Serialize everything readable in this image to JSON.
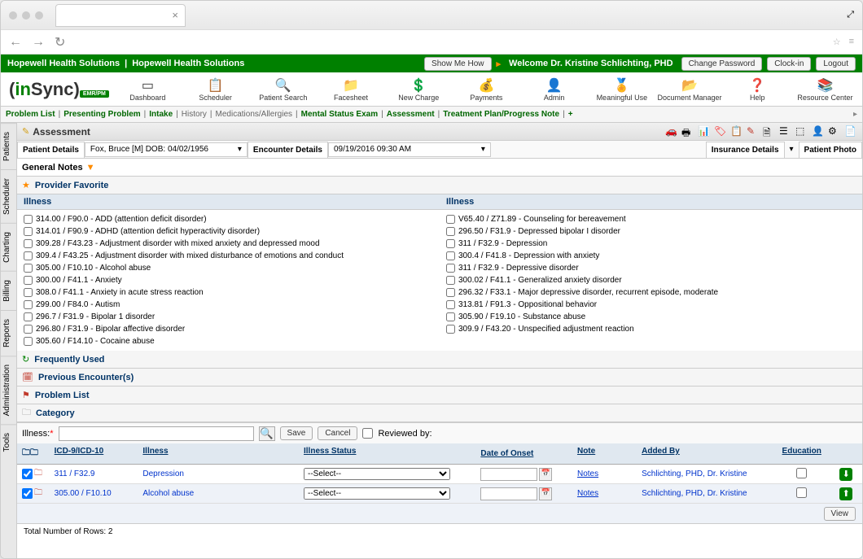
{
  "greenbar": {
    "org1": "Hopewell Health Solutions",
    "org2": "Hopewell Health Solutions",
    "showme": "Show Me How",
    "welcome": "Welcome Dr. Kristine Schlichting, PHD",
    "changepw": "Change Password",
    "clockin": "Clock-in",
    "logout": "Logout"
  },
  "logo": {
    "prefix": "in",
    "suffix": "Sync",
    "sub": "EMR/PM"
  },
  "toolbar": [
    {
      "label": "Dashboard",
      "icon": "▭"
    },
    {
      "label": "Scheduler",
      "icon": "📋"
    },
    {
      "label": "Patient Search",
      "icon": "🔍"
    },
    {
      "label": "Facesheet",
      "icon": "📁"
    },
    {
      "label": "New Charge",
      "icon": "💲"
    },
    {
      "label": "Payments",
      "icon": "💰"
    },
    {
      "label": "Admin",
      "icon": "👤"
    },
    {
      "label": "Meaningful Use",
      "icon": "🏅"
    },
    {
      "label": "Document Manager",
      "icon": "📂"
    },
    {
      "label": "Help",
      "icon": "❓"
    },
    {
      "label": "Resource Center",
      "icon": "📚"
    }
  ],
  "subnav": [
    {
      "label": "Problem List",
      "active": true
    },
    {
      "label": "Presenting Problem",
      "active": true
    },
    {
      "label": "Intake",
      "active": true
    },
    {
      "label": "History",
      "active": false
    },
    {
      "label": "Medications/Allergies",
      "active": false
    },
    {
      "label": "Mental Status Exam",
      "active": true
    },
    {
      "label": "Assessment",
      "active": true
    },
    {
      "label": "Treatment Plan/Progress Note",
      "active": true
    }
  ],
  "subnav_plus": "+",
  "sidetabs": [
    "Patients",
    "Scheduler",
    "Charting",
    "Billing",
    "Reports",
    "Administration",
    "Tools"
  ],
  "page_title": "Assessment",
  "details": {
    "patient_label": "Patient Details",
    "patient_val": "Fox, Bruce [M] DOB: 04/02/1956",
    "encounter_label": "Encounter Details",
    "encounter_val": "09/19/2016 09:30 AM",
    "insurance_label": "Insurance Details",
    "photo_label": "Patient Photo"
  },
  "gen_notes": "General Notes",
  "sections": {
    "fav": "Provider Favorite",
    "freq": "Frequently Used",
    "prev": "Previous Encounter(s)",
    "prob": "Problem List",
    "cat": "Category"
  },
  "illness_header": "Illness",
  "illness_left": [
    "314.00 / F90.0 - ADD (attention deficit disorder)",
    "314.01 / F90.9 - ADHD (attention deficit hyperactivity disorder)",
    "309.28 / F43.23 - Adjustment disorder with mixed anxiety and depressed mood",
    "309.4 / F43.25 - Adjustment disorder with mixed disturbance of emotions and conduct",
    "305.00 / F10.10 - Alcohol abuse",
    "300.00 / F41.1 - Anxiety",
    "308.0 / F41.1 - Anxiety in acute stress reaction",
    "299.00 / F84.0 - Autism",
    "296.7 / F31.9 - Bipolar 1 disorder",
    "296.80 / F31.9 - Bipolar affective disorder",
    "305.60 / F14.10 - Cocaine abuse"
  ],
  "illness_right": [
    "V65.40 / Z71.89 - Counseling for bereavement",
    "296.50 / F31.9 - Depressed bipolar I disorder",
    "311 / F32.9 - Depression",
    "300.4 / F41.8 - Depression with anxiety",
    "311 / F32.9 - Depressive disorder",
    "300.02 / F41.1 - Generalized anxiety disorder",
    "296.32 / F33.1 - Major depressive disorder, recurrent episode, moderate",
    "313.81 / F91.3 - Oppositional behavior",
    "305.90 / F19.10 - Substance abuse",
    "309.9 / F43.20 - Unspecified adjustment reaction"
  ],
  "filter": {
    "label": "Illness:",
    "save": "Save",
    "cancel": "Cancel",
    "reviewed": "Reviewed by:"
  },
  "grid": {
    "headers": {
      "icd": "ICD-9/ICD-10",
      "illness": "Illness",
      "status": "Illness Status",
      "date": "Date of Onset",
      "note": "Note",
      "added": "Added By",
      "edu": "Education"
    },
    "select_placeholder": "--Select--",
    "notes_link": "Notes",
    "rows": [
      {
        "icd": "311 / F32.9",
        "illness": "Depression",
        "added": "Schlichting, PHD, Dr. Kristine",
        "action": "down"
      },
      {
        "icd": "305.00 / F10.10",
        "illness": "Alcohol abuse",
        "added": "Schlichting, PHD, Dr. Kristine",
        "action": "up"
      }
    ],
    "view": "View",
    "total": "Total Number of Rows: 2"
  }
}
